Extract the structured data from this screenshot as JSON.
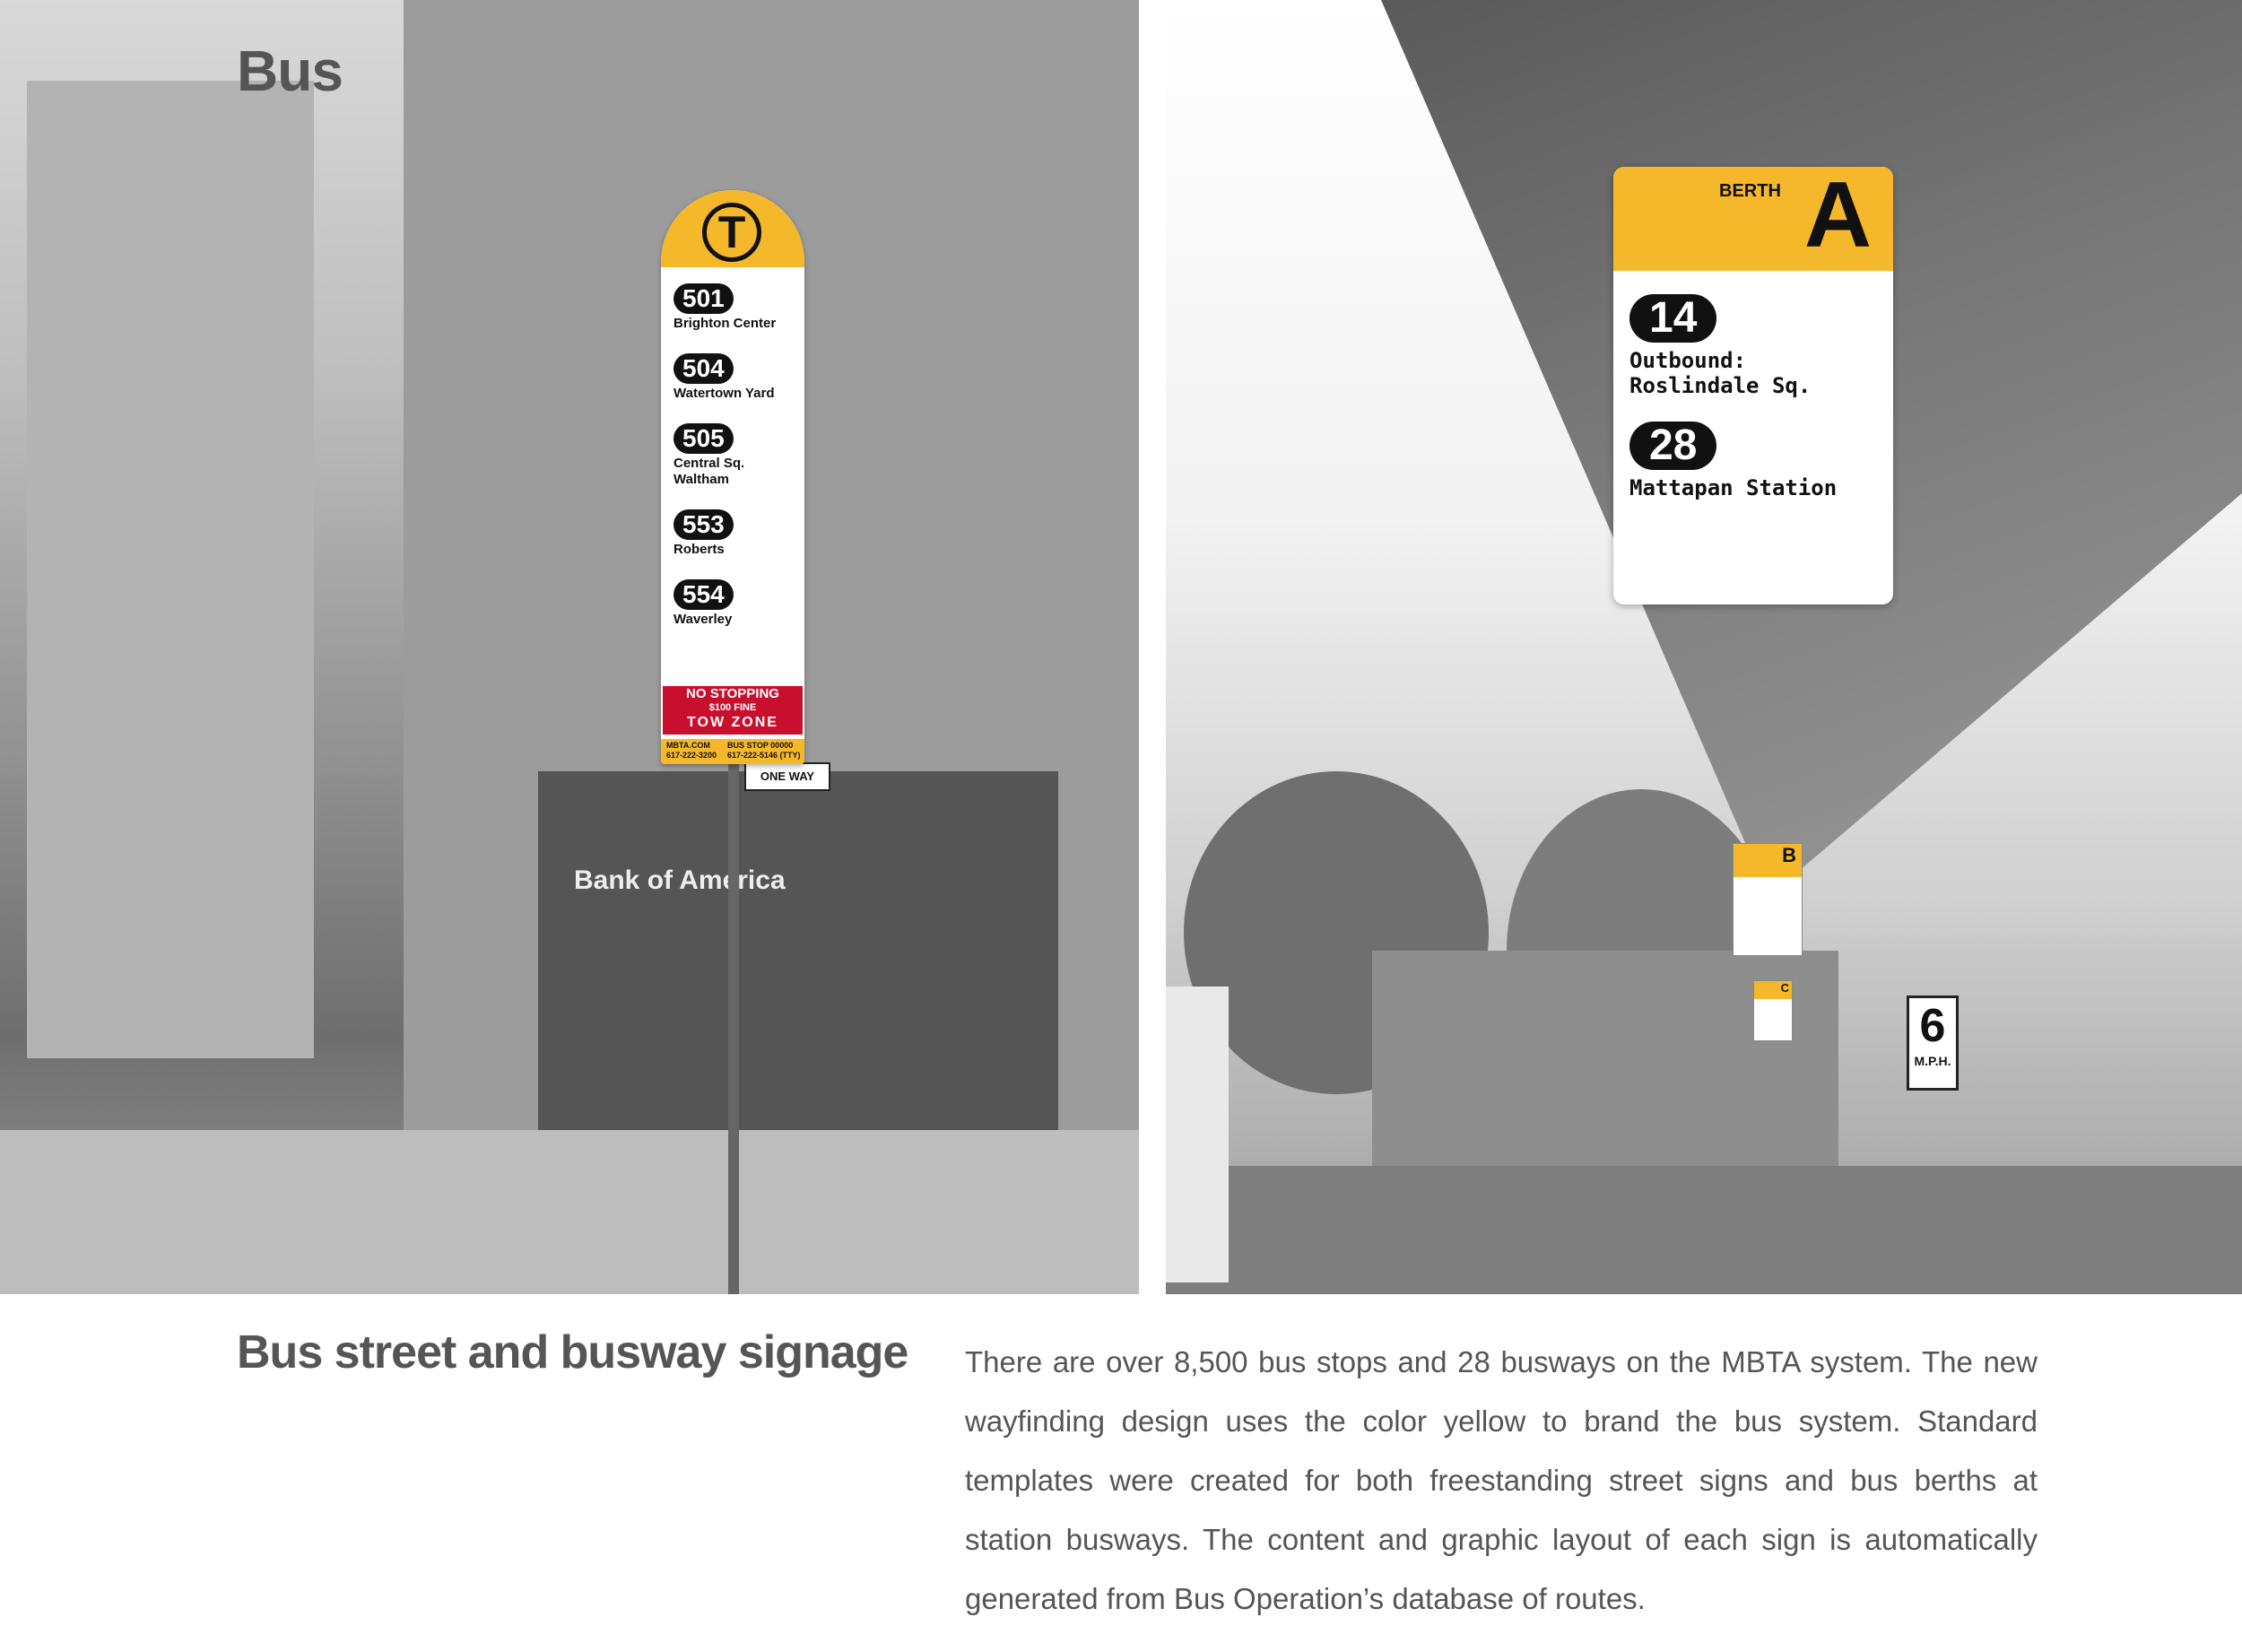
{
  "page": {
    "title": "Bus",
    "section_title": "Bus street and busway signage",
    "body": "There are over 8,500 bus stops and 28 busways on the MBTA system. The new wayfinding design uses the color yellow to brand the bus system. Standard templates were created for both freestanding street signs and bus berths at station busways. The content and graphic layout of each sign is automatically generated from Bus Operation’s database of routes."
  },
  "street_sign": {
    "logo": "T",
    "routes": [
      {
        "number": "501",
        "destination": "Brighton Center"
      },
      {
        "number": "504",
        "destination": "Watertown Yard"
      },
      {
        "number": "505",
        "destination": "Central Sq. Waltham"
      },
      {
        "number": "553",
        "destination": "Roberts"
      },
      {
        "number": "554",
        "destination": "Waverley"
      }
    ],
    "no_stopping": {
      "line1": "NO STOPPING",
      "line2": "$100 FINE",
      "line3": "TOW ZONE"
    },
    "footer": {
      "left_1": "MBTA.COM",
      "left_2": "617-222-3200",
      "right_1": "BUS STOP 00000",
      "right_2": "617-222-5146 (TTY)"
    }
  },
  "berth_sign": {
    "label": "BERTH",
    "letter": "A",
    "routes": [
      {
        "number": "14",
        "destination": "Outbound: Roslindale Sq."
      },
      {
        "number": "28",
        "destination": "Mattapan Station"
      }
    ]
  },
  "scene": {
    "speed_sign_number": "6",
    "speed_sign_unit": "M.P.H.",
    "mini_berth_b": "B",
    "mini_berth_c": "C",
    "one_way": "ONE WAY",
    "bank_name": "Bank of America"
  },
  "colors": {
    "brand_yellow": "#f5b82a",
    "red": "#c8102e",
    "text_gray": "#555555"
  }
}
